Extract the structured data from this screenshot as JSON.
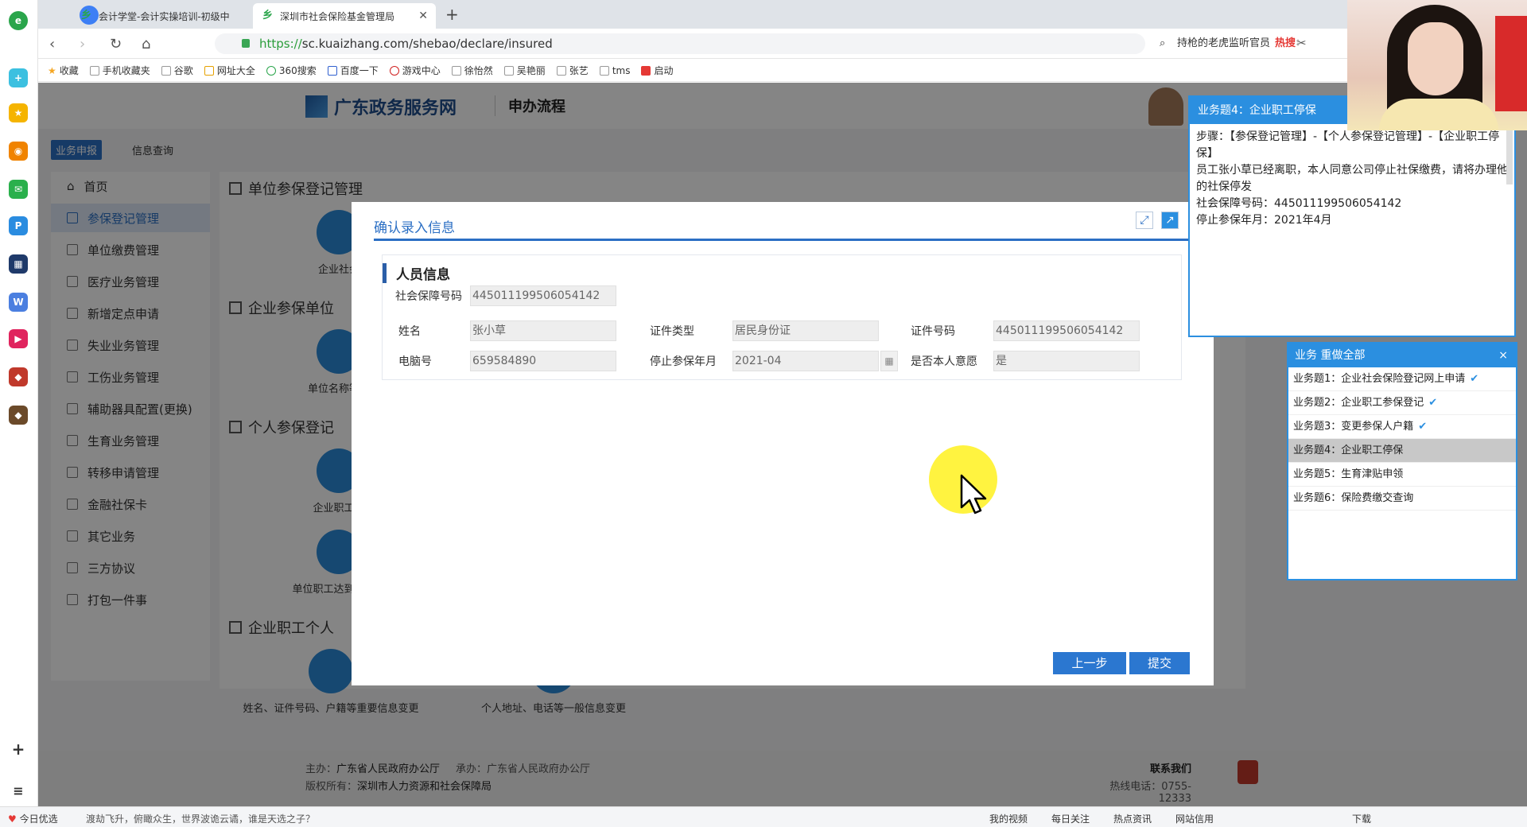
{
  "browser": {
    "tabs": [
      {
        "label": "会计学堂-会计实操培训-初级中"
      },
      {
        "label": "深圳市社会保险基金管理局"
      }
    ],
    "url_https": "https://",
    "url_rest": "sc.kuaizhang.com/shebao/declare/insured",
    "search_text": "持枪的老虎监听官员",
    "search_hot": "热搜",
    "bookmarks": [
      "收藏",
      "手机收藏夹",
      "谷歌",
      "网址大全",
      "360搜索",
      "百度一下",
      "游戏中心",
      "徐怡然",
      "吴艳丽",
      "张艺",
      "tms",
      "启动"
    ]
  },
  "site": {
    "title": "广东政务服务网",
    "subtitle": "申办流程",
    "nav_active": "业务申报",
    "nav_item": "信息查询"
  },
  "sidemenu": [
    "首页",
    "参保登记管理",
    "单位缴费管理",
    "医疗业务管理",
    "新增定点申请",
    "失业业务管理",
    "工伤业务管理",
    "辅助器具配置(更换)",
    "生育业务管理",
    "转移申请管理",
    "金融社保卡",
    "其它业务",
    "三方协议",
    "打包一件事"
  ],
  "content": {
    "sections": [
      "单位参保登记管理",
      "企业参保单位",
      "个人参保登记",
      "企业职工个人"
    ],
    "services": [
      "企业社会",
      "单位名称等关",
      "企业职工参",
      "单位职工达到退休条",
      "姓名、证件号码、户籍等重要信息变更",
      "个人地址、电话等一般信息变更"
    ]
  },
  "footer": {
    "sponsor_label": "主办：",
    "sponsor": "广东省人民政府办公厅",
    "organizer": "承办：广东省人民政府办公厅",
    "copyright_label": "版权所有：",
    "copyright": "深圳市人力资源和社会保障局",
    "contact": "联系我们",
    "hotline": "热线电话：0755-12333"
  },
  "dialog": {
    "title": "确认录入信息",
    "section": "人员信息",
    "fields": {
      "ssn_label": "社会保障号码",
      "ssn": "445011199506054142",
      "name_label": "姓名",
      "name": "张小草",
      "idtype_label": "证件类型",
      "idtype": "居民身份证",
      "idno_label": "证件号码",
      "idno": "445011199506054142",
      "pcno_label": "电脑号",
      "pcno": "659584890",
      "stop_label": "停止参保年月",
      "stop": "2021-04",
      "willing_label": "是否本人意愿",
      "willing": "是"
    },
    "prev": "上一步",
    "submit": "提交"
  },
  "task_panel": {
    "title": "业务题4：企业职工停保",
    "steps": "步骤：【参保登记管理】-【个人参保登记管理】-【企业职工停保】",
    "desc": "员工张小草已经离职，本人同意公司停止社保缴费，请将办理他的社保停发",
    "ssn_line": "社会保障号码：445011199506054142",
    "stop_line": "停止参保年月：2021年4月"
  },
  "biz_panel": {
    "head": "业务  重做全部",
    "close": "×",
    "items": [
      {
        "label": "业务题1：企业社会保险登记网上申请",
        "done": "✔"
      },
      {
        "label": "业务题2：企业职工参保登记",
        "done": "✔"
      },
      {
        "label": "业务题3：变更参保人户籍",
        "done": "✔"
      },
      {
        "label": "业务题4：企业职工停保",
        "done": ""
      },
      {
        "label": "业务题5：生育津贴申领",
        "done": ""
      },
      {
        "label": "业务题6：保险费缴交查询",
        "done": ""
      }
    ]
  },
  "statusbar": {
    "left1": "今日优选",
    "left2": "渡劫飞升，俯瞰众生，世界波诡云谲，谁是天选之子？",
    "items": [
      "我的视频",
      "每日关注",
      "热点资讯",
      "网站信用",
      "下载"
    ]
  }
}
